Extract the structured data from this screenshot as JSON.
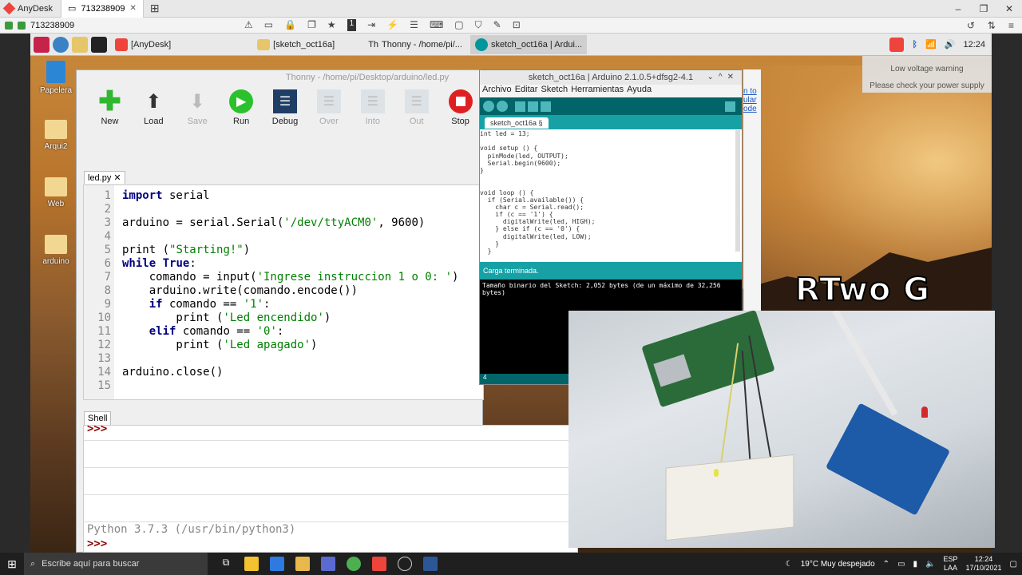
{
  "anydesk": {
    "app_name": "AnyDesk",
    "tab_label": "713238909",
    "address": "713238909"
  },
  "rpi_panel": {
    "tasks": [
      "[AnyDesk]",
      "[sketch_oct16a]",
      "Thonny - /home/pi/...",
      "sketch_oct16a | Ardui..."
    ],
    "time": "12:24"
  },
  "low_voltage": {
    "title": "Low voltage warning",
    "message": "Please check your power supply"
  },
  "desktop_icons": [
    "Papelera",
    "Arqui2",
    "Web",
    "arduino"
  ],
  "thonny": {
    "title": "Thonny - /home/pi/Desktop/arduino/led.py",
    "toolbar": [
      "New",
      "Load",
      "Save",
      "Run",
      "Debug",
      "Over",
      "Into",
      "Out",
      "Stop"
    ],
    "tab": "led.py",
    "lines": [
      {
        "n": "1",
        "text": "import serial"
      },
      {
        "n": "2",
        "text": ""
      },
      {
        "n": "3",
        "text": "arduino = serial.Serial('/dev/ttyACM0', 9600)"
      },
      {
        "n": "4",
        "text": ""
      },
      {
        "n": "5",
        "text": "print (\"Starting!\")"
      },
      {
        "n": "6",
        "text": "while True:"
      },
      {
        "n": "7",
        "text": "    comando = input('Ingrese instruccion 1 o 0: ')"
      },
      {
        "n": "8",
        "text": "    arduino.write(comando.encode())"
      },
      {
        "n": "9",
        "text": "    if comando == '1':"
      },
      {
        "n": "10",
        "text": "        print ('Led encendido')"
      },
      {
        "n": "11",
        "text": "    elif comando == '0':"
      },
      {
        "n": "12",
        "text": "        print ('Led apagado')"
      },
      {
        "n": "13",
        "text": ""
      },
      {
        "n": "14",
        "text": "arduino.close()"
      },
      {
        "n": "15",
        "text": ""
      }
    ],
    "shell_tab": "Shell",
    "shell_prompt": ">>>",
    "python_version": "Python 3.7.3 (/usr/bin/python3)"
  },
  "arduino": {
    "title": "sketch_oct16a | Arduino 2.1.0.5+dfsg2-4.1",
    "menu": [
      "Archivo",
      "Editar",
      "Sketch",
      "Herramientas",
      "Ayuda"
    ],
    "tab": "sketch_oct16a §",
    "code": [
      "int led = 13;",
      "",
      "void setup () {",
      "  pinMode(led, OUTPUT);",
      "  Serial.begin(9600);",
      "}",
      "",
      "",
      "void loop () {",
      "  if (Serial.available()) {",
      "    char c = Serial.read();",
      "    if (c == '1') {",
      "      digitalWrite(led, HIGH);",
      "    } else if (c == '0') {",
      "      digitalWrite(led, LOW);",
      "    }",
      "  }"
    ],
    "status": "Carga terminada.",
    "console": "Tamaño binario del Sketch: 2,052 bytes (de un máximo de 32,256 bytes)",
    "footer_line": "4",
    "side_link": "n to ular ode"
  },
  "watermark": "RTwo G",
  "taskbar": {
    "search_placeholder": "Escribe aquí para buscar",
    "weather": "19°C  Muy despejado",
    "lang": "ESP",
    "lang2": "LAA",
    "time": "12:24",
    "date": "17/10/2021"
  }
}
